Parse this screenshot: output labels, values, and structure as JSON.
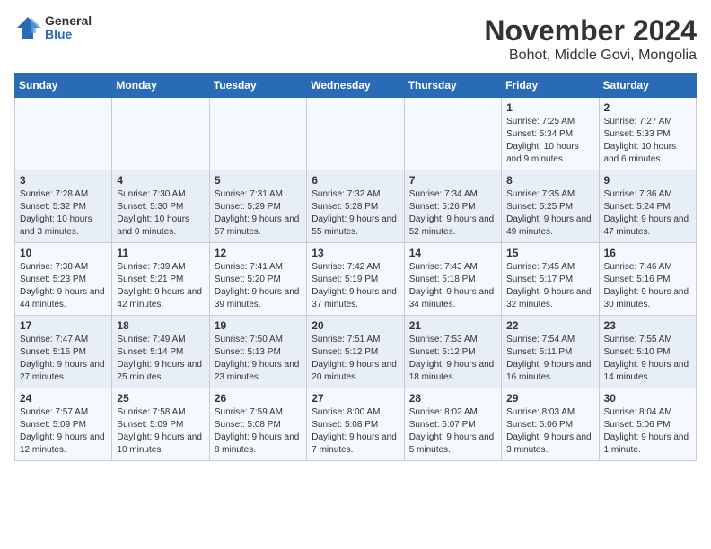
{
  "logo": {
    "general": "General",
    "blue": "Blue"
  },
  "title": "November 2024",
  "location": "Bohot, Middle Govi, Mongolia",
  "weekdays": [
    "Sunday",
    "Monday",
    "Tuesday",
    "Wednesday",
    "Thursday",
    "Friday",
    "Saturday"
  ],
  "weeks": [
    [
      {
        "day": "",
        "info": ""
      },
      {
        "day": "",
        "info": ""
      },
      {
        "day": "",
        "info": ""
      },
      {
        "day": "",
        "info": ""
      },
      {
        "day": "",
        "info": ""
      },
      {
        "day": "1",
        "info": "Sunrise: 7:25 AM\nSunset: 5:34 PM\nDaylight: 10 hours and 9 minutes."
      },
      {
        "day": "2",
        "info": "Sunrise: 7:27 AM\nSunset: 5:33 PM\nDaylight: 10 hours and 6 minutes."
      }
    ],
    [
      {
        "day": "3",
        "info": "Sunrise: 7:28 AM\nSunset: 5:32 PM\nDaylight: 10 hours and 3 minutes."
      },
      {
        "day": "4",
        "info": "Sunrise: 7:30 AM\nSunset: 5:30 PM\nDaylight: 10 hours and 0 minutes."
      },
      {
        "day": "5",
        "info": "Sunrise: 7:31 AM\nSunset: 5:29 PM\nDaylight: 9 hours and 57 minutes."
      },
      {
        "day": "6",
        "info": "Sunrise: 7:32 AM\nSunset: 5:28 PM\nDaylight: 9 hours and 55 minutes."
      },
      {
        "day": "7",
        "info": "Sunrise: 7:34 AM\nSunset: 5:26 PM\nDaylight: 9 hours and 52 minutes."
      },
      {
        "day": "8",
        "info": "Sunrise: 7:35 AM\nSunset: 5:25 PM\nDaylight: 9 hours and 49 minutes."
      },
      {
        "day": "9",
        "info": "Sunrise: 7:36 AM\nSunset: 5:24 PM\nDaylight: 9 hours and 47 minutes."
      }
    ],
    [
      {
        "day": "10",
        "info": "Sunrise: 7:38 AM\nSunset: 5:23 PM\nDaylight: 9 hours and 44 minutes."
      },
      {
        "day": "11",
        "info": "Sunrise: 7:39 AM\nSunset: 5:21 PM\nDaylight: 9 hours and 42 minutes."
      },
      {
        "day": "12",
        "info": "Sunrise: 7:41 AM\nSunset: 5:20 PM\nDaylight: 9 hours and 39 minutes."
      },
      {
        "day": "13",
        "info": "Sunrise: 7:42 AM\nSunset: 5:19 PM\nDaylight: 9 hours and 37 minutes."
      },
      {
        "day": "14",
        "info": "Sunrise: 7:43 AM\nSunset: 5:18 PM\nDaylight: 9 hours and 34 minutes."
      },
      {
        "day": "15",
        "info": "Sunrise: 7:45 AM\nSunset: 5:17 PM\nDaylight: 9 hours and 32 minutes."
      },
      {
        "day": "16",
        "info": "Sunrise: 7:46 AM\nSunset: 5:16 PM\nDaylight: 9 hours and 30 minutes."
      }
    ],
    [
      {
        "day": "17",
        "info": "Sunrise: 7:47 AM\nSunset: 5:15 PM\nDaylight: 9 hours and 27 minutes."
      },
      {
        "day": "18",
        "info": "Sunrise: 7:49 AM\nSunset: 5:14 PM\nDaylight: 9 hours and 25 minutes."
      },
      {
        "day": "19",
        "info": "Sunrise: 7:50 AM\nSunset: 5:13 PM\nDaylight: 9 hours and 23 minutes."
      },
      {
        "day": "20",
        "info": "Sunrise: 7:51 AM\nSunset: 5:12 PM\nDaylight: 9 hours and 20 minutes."
      },
      {
        "day": "21",
        "info": "Sunrise: 7:53 AM\nSunset: 5:12 PM\nDaylight: 9 hours and 18 minutes."
      },
      {
        "day": "22",
        "info": "Sunrise: 7:54 AM\nSunset: 5:11 PM\nDaylight: 9 hours and 16 minutes."
      },
      {
        "day": "23",
        "info": "Sunrise: 7:55 AM\nSunset: 5:10 PM\nDaylight: 9 hours and 14 minutes."
      }
    ],
    [
      {
        "day": "24",
        "info": "Sunrise: 7:57 AM\nSunset: 5:09 PM\nDaylight: 9 hours and 12 minutes."
      },
      {
        "day": "25",
        "info": "Sunrise: 7:58 AM\nSunset: 5:09 PM\nDaylight: 9 hours and 10 minutes."
      },
      {
        "day": "26",
        "info": "Sunrise: 7:59 AM\nSunset: 5:08 PM\nDaylight: 9 hours and 8 minutes."
      },
      {
        "day": "27",
        "info": "Sunrise: 8:00 AM\nSunset: 5:08 PM\nDaylight: 9 hours and 7 minutes."
      },
      {
        "day": "28",
        "info": "Sunrise: 8:02 AM\nSunset: 5:07 PM\nDaylight: 9 hours and 5 minutes."
      },
      {
        "day": "29",
        "info": "Sunrise: 8:03 AM\nSunset: 5:06 PM\nDaylight: 9 hours and 3 minutes."
      },
      {
        "day": "30",
        "info": "Sunrise: 8:04 AM\nSunset: 5:06 PM\nDaylight: 9 hours and 1 minute."
      }
    ]
  ]
}
